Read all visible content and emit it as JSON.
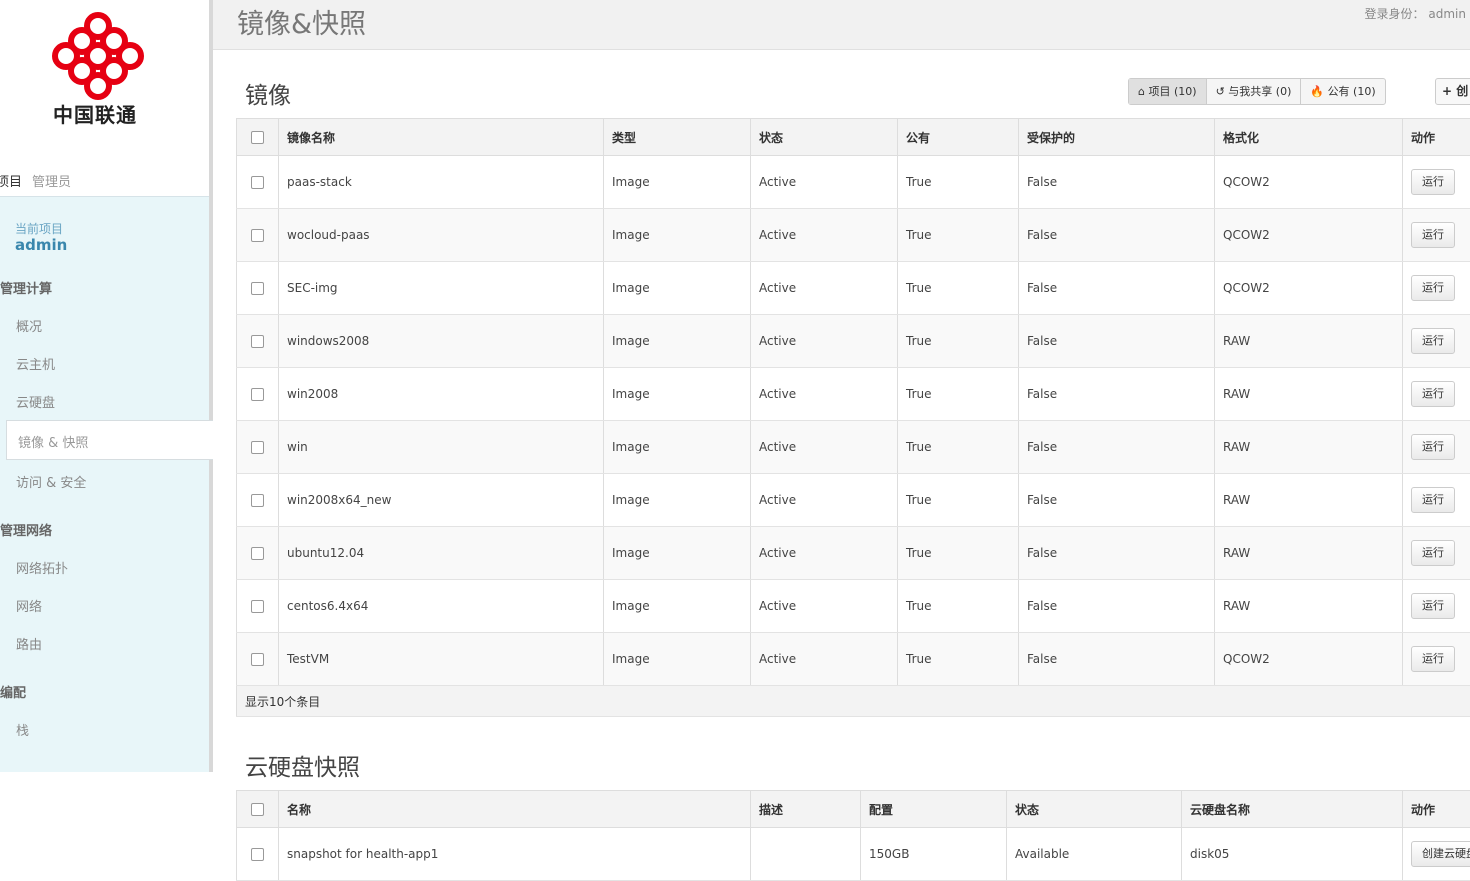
{
  "brand": {
    "name": "中国联通"
  },
  "sidebar": {
    "tabs": [
      "项目",
      "管理员"
    ],
    "current_project_label": "当前项目",
    "current_project": "admin",
    "categories": [
      {
        "name": "管理计算",
        "items": [
          "概况",
          "云主机",
          "云硬盘",
          "镜像 & 快照",
          "访问 & 安全"
        ]
      },
      {
        "name": "管理网络",
        "items": [
          "网络拓扑",
          "网络",
          "路由"
        ]
      },
      {
        "name": "编配",
        "items": [
          "栈"
        ]
      }
    ],
    "active_item": "镜像 & 快照"
  },
  "header": {
    "title": "镜像&快照",
    "login_label": "登录身份：",
    "login_user": "admin"
  },
  "images": {
    "title": "镜像",
    "filters": [
      "项目 (10)",
      "与我共享 (0)",
      "公有 (10)"
    ],
    "create_label": "创",
    "columns": [
      "镜像名称",
      "类型",
      "状态",
      "公有",
      "受保护的",
      "格式化",
      "动作"
    ],
    "rows": [
      [
        "paas-stack",
        "Image",
        "Active",
        "True",
        "False",
        "QCOW2"
      ],
      [
        "wocloud-paas",
        "Image",
        "Active",
        "True",
        "False",
        "QCOW2"
      ],
      [
        "SEC-img",
        "Image",
        "Active",
        "True",
        "False",
        "QCOW2"
      ],
      [
        "windows2008",
        "Image",
        "Active",
        "True",
        "False",
        "RAW"
      ],
      [
        "win2008",
        "Image",
        "Active",
        "True",
        "False",
        "RAW"
      ],
      [
        "win",
        "Image",
        "Active",
        "True",
        "False",
        "RAW"
      ],
      [
        "win2008x64_new",
        "Image",
        "Active",
        "True",
        "False",
        "RAW"
      ],
      [
        "ubuntu12.04",
        "Image",
        "Active",
        "True",
        "False",
        "RAW"
      ],
      [
        "centos6.4x64",
        "Image",
        "Active",
        "True",
        "False",
        "RAW"
      ],
      [
        "TestVM",
        "Image",
        "Active",
        "True",
        "False",
        "QCOW2"
      ]
    ],
    "action_label": "运行",
    "footer": "显示10个条目"
  },
  "snapshots": {
    "title": "云硬盘快照",
    "columns": [
      "名称",
      "描述",
      "配置",
      "状态",
      "云硬盘名称",
      "动作"
    ],
    "rows": [
      [
        "snapshot for health-app1",
        "",
        "150GB",
        "Available",
        "disk05"
      ]
    ],
    "action_label": "创建云硬盘"
  },
  "colors": {
    "accent": "#3a87ad",
    "sidebar_bg": "#e8f6f9",
    "logo_red": "#e60012"
  }
}
